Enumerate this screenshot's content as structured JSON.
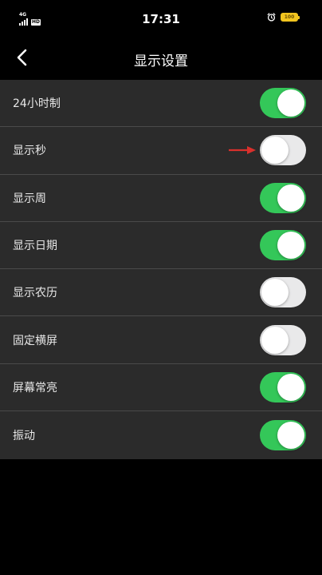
{
  "statusbar": {
    "network": "4G",
    "hd": "HD",
    "time": "17:31",
    "battery": "100",
    "signal_icon": "signal-bars-icon",
    "alarm_icon": "alarm-clock-icon",
    "battery_color": "#f2c51f"
  },
  "navbar": {
    "title": "显示设置",
    "back_icon": "chevron-left-icon"
  },
  "settings": [
    {
      "label": "24小时制",
      "on": true
    },
    {
      "label": "显示秒",
      "on": false
    },
    {
      "label": "显示周",
      "on": true
    },
    {
      "label": "显示日期",
      "on": true
    },
    {
      "label": "显示农历",
      "on": false
    },
    {
      "label": "固定横屏",
      "on": false
    },
    {
      "label": "屏幕常亮",
      "on": true
    },
    {
      "label": "振动",
      "on": true
    }
  ],
  "colors": {
    "toggle_on": "#34c759",
    "toggle_off": "#e9e9ea",
    "row_background": "#2b2b2b",
    "annotation_arrow": "#d9302c"
  },
  "annotation": {
    "arrow_row": 1,
    "icon": "red-arrow-icon"
  }
}
